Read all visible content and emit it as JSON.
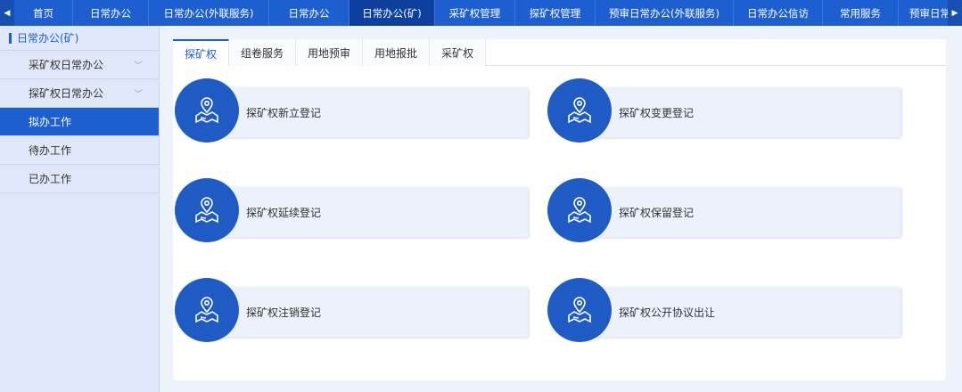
{
  "topnav": {
    "items": [
      {
        "label": "首页"
      },
      {
        "label": "日常办公"
      },
      {
        "label": "日常办公(外联服务)"
      },
      {
        "label": "日常办公"
      },
      {
        "label": "日常办公(矿)"
      },
      {
        "label": "采矿权管理"
      },
      {
        "label": "探矿权管理"
      },
      {
        "label": "预审日常办公(外联服务)"
      },
      {
        "label": "日常办公信访"
      },
      {
        "label": "常用服务"
      },
      {
        "label": "预审日常"
      }
    ]
  },
  "sidebar": {
    "title": "日常办公(矿)",
    "items": [
      {
        "label": "采矿权日常办公"
      },
      {
        "label": "探矿权日常办公"
      },
      {
        "label": "拟办工作"
      },
      {
        "label": "待办工作"
      },
      {
        "label": "已办工作"
      }
    ]
  },
  "tabs": [
    {
      "label": "探矿权"
    },
    {
      "label": "组卷服务"
    },
    {
      "label": "用地预审"
    },
    {
      "label": "用地报批"
    },
    {
      "label": "采矿权"
    }
  ],
  "tiles": [
    {
      "label": "探矿权新立登记"
    },
    {
      "label": "探矿权变更登记"
    },
    {
      "label": "探矿权延续登记"
    },
    {
      "label": "探矿权保留登记"
    },
    {
      "label": "探矿权注销登记"
    },
    {
      "label": "探矿权公开协议出让"
    }
  ]
}
